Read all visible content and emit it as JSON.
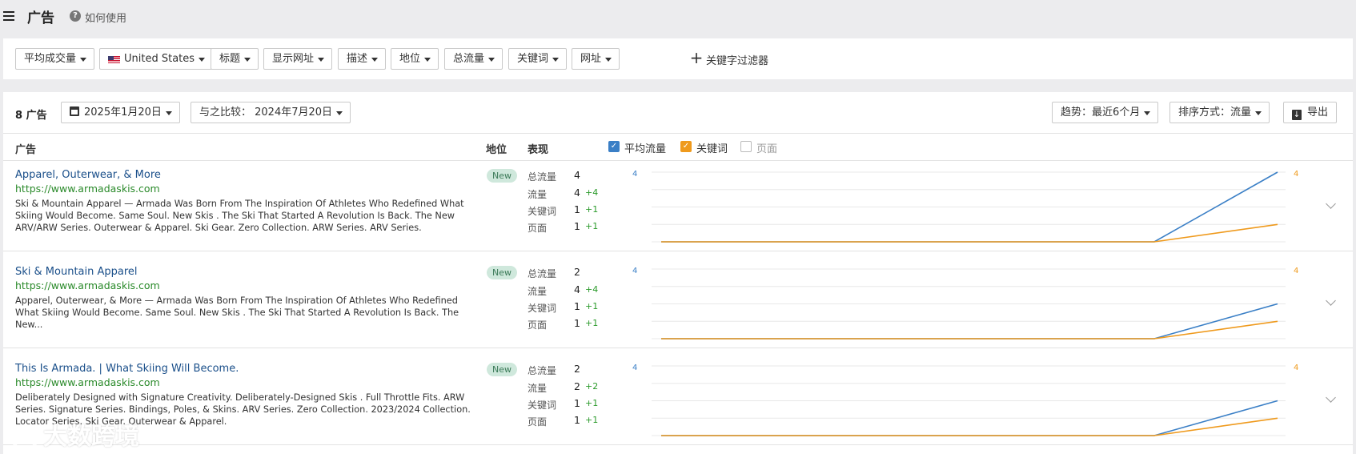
{
  "header": {
    "title": "广告",
    "help_label": "如何使用"
  },
  "filters": {
    "items": [
      "平均成交量",
      "United States",
      "标题",
      "显示网址",
      "描述",
      "地位",
      "总流量",
      "关键词",
      "网址"
    ],
    "keyword_filter_label": "关键字过滤器"
  },
  "toolbar": {
    "count_label": "8 广告",
    "date_label": "2025年1月20日",
    "compare_label": "与之比较：  2024年7月20日",
    "trend_label": "趋势：最近6个月",
    "sort_label": "排序方式：流量",
    "export_label": "导出"
  },
  "table": {
    "col_ad": "广告",
    "col_position": "地位",
    "col_performance": "表现",
    "legend": [
      {
        "label": "平均流量",
        "checked": true,
        "color": "#3a7fc6"
      },
      {
        "label": "关键词",
        "checked": true,
        "color": "#ef9a1d"
      },
      {
        "label": "页面",
        "checked": false,
        "color": "#999999"
      }
    ],
    "metric_labels": [
      "总流量",
      "流量",
      "关键词",
      "页面"
    ]
  },
  "rows": [
    {
      "title": "Apparel, Outerwear, & More",
      "url": "https://www.armadaskis.com",
      "desc": "Ski & Mountain Apparel — Armada Was Born From The Inspiration Of Athletes Who Redefined What Skiing Would Become. Same Soul. New Skis . The Ski That Started A Revolution Is Back. The New ARV/ARW Series. Outerwear & Apparel. Ski Gear. Zero Collection. ARW Series. ARV Series.",
      "badge": "New",
      "metrics": [
        {
          "value": "4",
          "delta": ""
        },
        {
          "value": "4",
          "delta": "+4"
        },
        {
          "value": "1",
          "delta": "+1"
        },
        {
          "value": "1",
          "delta": "+1"
        }
      ],
      "axis_left": "4",
      "axis_right": "4",
      "trend_traffic": [
        0,
        0,
        0,
        0,
        0,
        4
      ],
      "trend_keywords": [
        0,
        0,
        0,
        0,
        0,
        1
      ]
    },
    {
      "title": "Ski & Mountain Apparel",
      "url": "https://www.armadaskis.com",
      "desc": "Apparel, Outerwear, & More — Armada Was Born From The Inspiration Of Athletes Who Redefined What Skiing Would Become. Same Soul. New Skis . The Ski That Started A Revolution Is Back. The New...",
      "badge": "New",
      "metrics": [
        {
          "value": "2",
          "delta": ""
        },
        {
          "value": "4",
          "delta": "+4"
        },
        {
          "value": "1",
          "delta": "+1"
        },
        {
          "value": "1",
          "delta": "+1"
        }
      ],
      "axis_left": "4",
      "axis_right": "4",
      "trend_traffic": [
        0,
        0,
        0,
        0,
        0,
        2
      ],
      "trend_keywords": [
        0,
        0,
        0,
        0,
        0,
        1
      ]
    },
    {
      "title": "This Is Armada. | What Skiing Will Become.",
      "url": "https://www.armadaskis.com",
      "desc": "Deliberately Designed with Signature Creativity. Deliberately-Designed Skis . Full Throttle Fits. ARW Series. Signature Series. Bindings, Poles, & Skins. ARV Series. Zero Collection. 2023/2024 Collection. Locator Series. Ski Gear. Outerwear & Apparel.",
      "badge": "New",
      "metrics": [
        {
          "value": "2",
          "delta": ""
        },
        {
          "value": "2",
          "delta": "+2"
        },
        {
          "value": "1",
          "delta": "+1"
        },
        {
          "value": "1",
          "delta": "+1"
        }
      ],
      "axis_left": "4",
      "axis_right": "4",
      "trend_traffic": [
        0,
        0,
        0,
        0,
        0,
        2
      ],
      "trend_keywords": [
        0,
        0,
        0,
        0,
        0,
        1
      ]
    }
  ],
  "watermark": "大数跨境"
}
